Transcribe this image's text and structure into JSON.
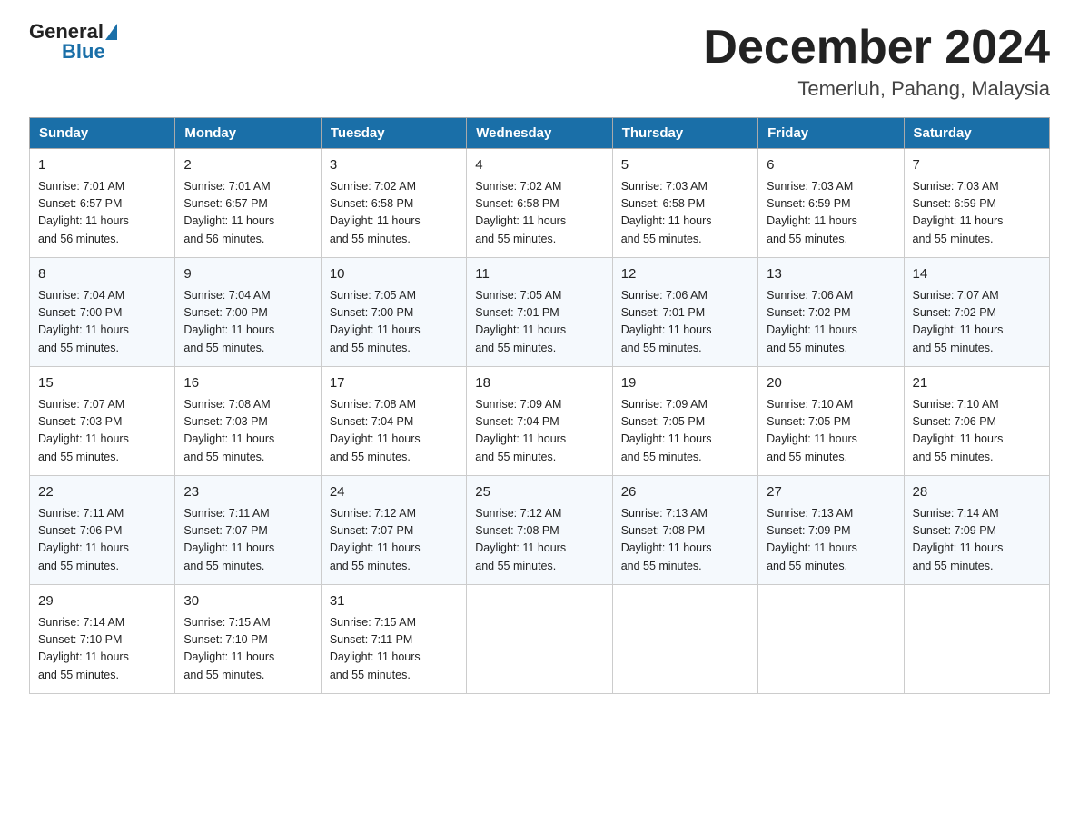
{
  "header": {
    "logo_general": "General",
    "logo_blue": "Blue",
    "month_title": "December 2024",
    "location": "Temerluh, Pahang, Malaysia"
  },
  "days_of_week": [
    "Sunday",
    "Monday",
    "Tuesday",
    "Wednesday",
    "Thursday",
    "Friday",
    "Saturday"
  ],
  "weeks": [
    [
      {
        "day": "1",
        "sunrise": "7:01 AM",
        "sunset": "6:57 PM",
        "daylight": "11 hours and 56 minutes."
      },
      {
        "day": "2",
        "sunrise": "7:01 AM",
        "sunset": "6:57 PM",
        "daylight": "11 hours and 56 minutes."
      },
      {
        "day": "3",
        "sunrise": "7:02 AM",
        "sunset": "6:58 PM",
        "daylight": "11 hours and 55 minutes."
      },
      {
        "day": "4",
        "sunrise": "7:02 AM",
        "sunset": "6:58 PM",
        "daylight": "11 hours and 55 minutes."
      },
      {
        "day": "5",
        "sunrise": "7:03 AM",
        "sunset": "6:58 PM",
        "daylight": "11 hours and 55 minutes."
      },
      {
        "day": "6",
        "sunrise": "7:03 AM",
        "sunset": "6:59 PM",
        "daylight": "11 hours and 55 minutes."
      },
      {
        "day": "7",
        "sunrise": "7:03 AM",
        "sunset": "6:59 PM",
        "daylight": "11 hours and 55 minutes."
      }
    ],
    [
      {
        "day": "8",
        "sunrise": "7:04 AM",
        "sunset": "7:00 PM",
        "daylight": "11 hours and 55 minutes."
      },
      {
        "day": "9",
        "sunrise": "7:04 AM",
        "sunset": "7:00 PM",
        "daylight": "11 hours and 55 minutes."
      },
      {
        "day": "10",
        "sunrise": "7:05 AM",
        "sunset": "7:00 PM",
        "daylight": "11 hours and 55 minutes."
      },
      {
        "day": "11",
        "sunrise": "7:05 AM",
        "sunset": "7:01 PM",
        "daylight": "11 hours and 55 minutes."
      },
      {
        "day": "12",
        "sunrise": "7:06 AM",
        "sunset": "7:01 PM",
        "daylight": "11 hours and 55 minutes."
      },
      {
        "day": "13",
        "sunrise": "7:06 AM",
        "sunset": "7:02 PM",
        "daylight": "11 hours and 55 minutes."
      },
      {
        "day": "14",
        "sunrise": "7:07 AM",
        "sunset": "7:02 PM",
        "daylight": "11 hours and 55 minutes."
      }
    ],
    [
      {
        "day": "15",
        "sunrise": "7:07 AM",
        "sunset": "7:03 PM",
        "daylight": "11 hours and 55 minutes."
      },
      {
        "day": "16",
        "sunrise": "7:08 AM",
        "sunset": "7:03 PM",
        "daylight": "11 hours and 55 minutes."
      },
      {
        "day": "17",
        "sunrise": "7:08 AM",
        "sunset": "7:04 PM",
        "daylight": "11 hours and 55 minutes."
      },
      {
        "day": "18",
        "sunrise": "7:09 AM",
        "sunset": "7:04 PM",
        "daylight": "11 hours and 55 minutes."
      },
      {
        "day": "19",
        "sunrise": "7:09 AM",
        "sunset": "7:05 PM",
        "daylight": "11 hours and 55 minutes."
      },
      {
        "day": "20",
        "sunrise": "7:10 AM",
        "sunset": "7:05 PM",
        "daylight": "11 hours and 55 minutes."
      },
      {
        "day": "21",
        "sunrise": "7:10 AM",
        "sunset": "7:06 PM",
        "daylight": "11 hours and 55 minutes."
      }
    ],
    [
      {
        "day": "22",
        "sunrise": "7:11 AM",
        "sunset": "7:06 PM",
        "daylight": "11 hours and 55 minutes."
      },
      {
        "day": "23",
        "sunrise": "7:11 AM",
        "sunset": "7:07 PM",
        "daylight": "11 hours and 55 minutes."
      },
      {
        "day": "24",
        "sunrise": "7:12 AM",
        "sunset": "7:07 PM",
        "daylight": "11 hours and 55 minutes."
      },
      {
        "day": "25",
        "sunrise": "7:12 AM",
        "sunset": "7:08 PM",
        "daylight": "11 hours and 55 minutes."
      },
      {
        "day": "26",
        "sunrise": "7:13 AM",
        "sunset": "7:08 PM",
        "daylight": "11 hours and 55 minutes."
      },
      {
        "day": "27",
        "sunrise": "7:13 AM",
        "sunset": "7:09 PM",
        "daylight": "11 hours and 55 minutes."
      },
      {
        "day": "28",
        "sunrise": "7:14 AM",
        "sunset": "7:09 PM",
        "daylight": "11 hours and 55 minutes."
      }
    ],
    [
      {
        "day": "29",
        "sunrise": "7:14 AM",
        "sunset": "7:10 PM",
        "daylight": "11 hours and 55 minutes."
      },
      {
        "day": "30",
        "sunrise": "7:15 AM",
        "sunset": "7:10 PM",
        "daylight": "11 hours and 55 minutes."
      },
      {
        "day": "31",
        "sunrise": "7:15 AM",
        "sunset": "7:11 PM",
        "daylight": "11 hours and 55 minutes."
      },
      null,
      null,
      null,
      null
    ]
  ],
  "labels": {
    "sunrise": "Sunrise:",
    "sunset": "Sunset:",
    "daylight": "Daylight:"
  }
}
